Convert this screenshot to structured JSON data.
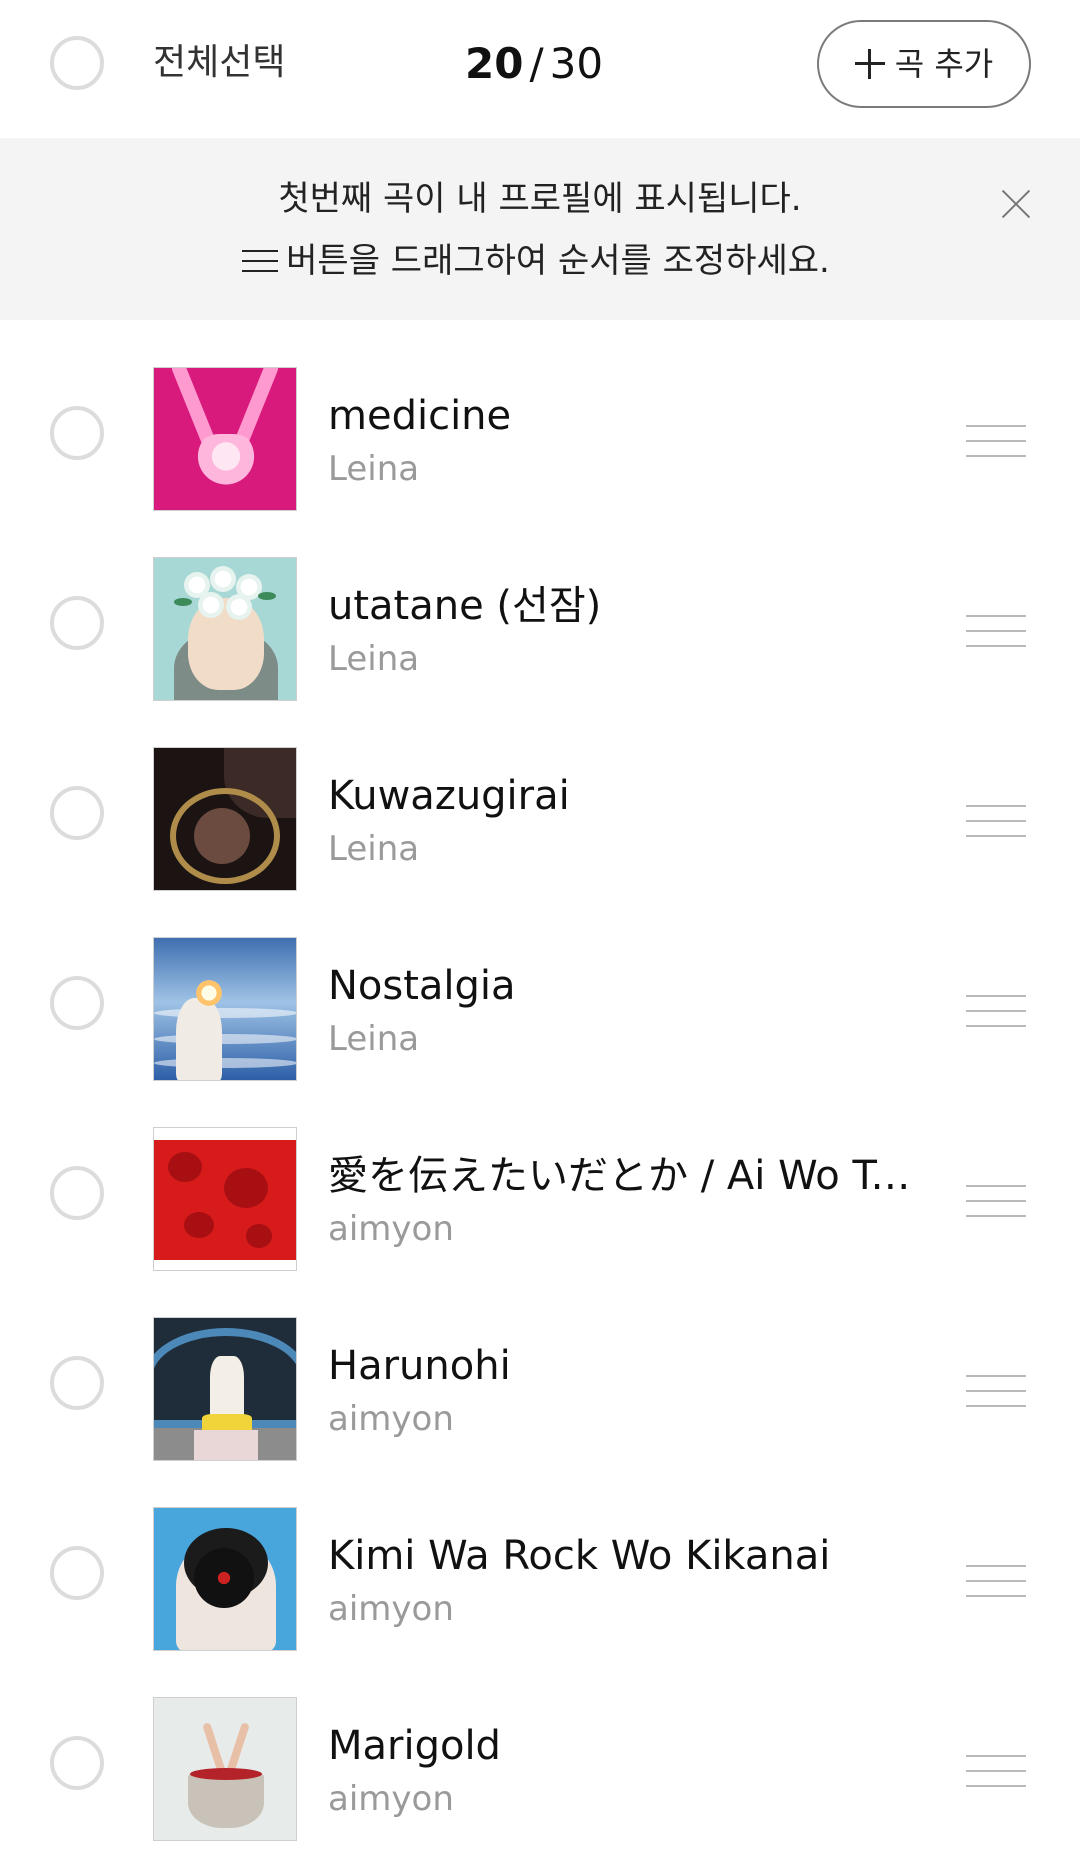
{
  "header": {
    "select_all_label": "전체선택",
    "count_selected": "20",
    "count_separator": "/",
    "count_total": "30",
    "add_song_label": "곡 추가"
  },
  "notice": {
    "line1": "첫번째 곡이 내 프로필에 표시됩니다.",
    "line2": "버튼을 드래그하여 순서를 조정하세요."
  },
  "songs": [
    {
      "title": "medicine",
      "artist": "Leina"
    },
    {
      "title": "utatane (선잠)",
      "artist": "Leina"
    },
    {
      "title": "Kuwazugirai",
      "artist": "Leina"
    },
    {
      "title": "Nostalgia",
      "artist": "Leina"
    },
    {
      "title": "愛を伝えたいだとか / Ai Wo Ts...",
      "artist": "aimyon"
    },
    {
      "title": "Harunohi",
      "artist": "aimyon"
    },
    {
      "title": "Kimi Wa Rock Wo Kikanai",
      "artist": "aimyon"
    },
    {
      "title": "Marigold",
      "artist": "aimyon"
    }
  ],
  "icons": {
    "add": "plus-icon",
    "close": "close-icon",
    "drag": "drag-handle-icon",
    "reorder_hint": "menu-icon"
  },
  "colors": {
    "banner_background": "#f4f4f4",
    "artist_text": "#9a9a9a",
    "radio_border": "#dcdcdc"
  }
}
